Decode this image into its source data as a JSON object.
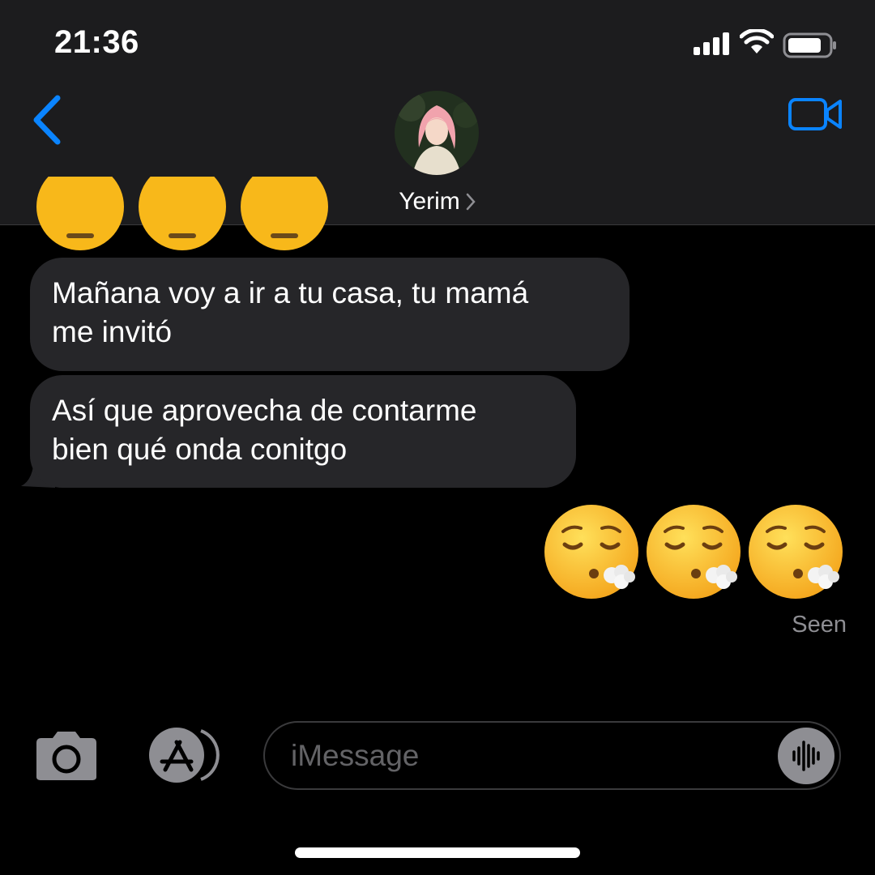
{
  "status_bar": {
    "time": "21:36"
  },
  "header": {
    "contact_name": "Yerim"
  },
  "messages": [
    {
      "side": "incoming",
      "text_line1": "Mañana voy a ir a tu casa, tu mamá",
      "text_line2": "me invitó"
    },
    {
      "side": "incoming",
      "text_line1": "Así que aprovecha de contarme",
      "text_line2": "bien qué onda conitgo"
    }
  ],
  "outgoing_emojis": [
    "face-exhaling",
    "face-exhaling",
    "face-exhaling"
  ],
  "partial_emojis": [
    "expressionless-face",
    "expressionless-face",
    "expressionless-face"
  ],
  "read_receipt": "Seen",
  "composer": {
    "placeholder": "iMessage"
  },
  "colors": {
    "accent": "#0a84ff",
    "header_bg": "#1c1c1e",
    "bubble_incoming": "#262629",
    "background": "#000000",
    "secondary_text": "#8e8e93"
  }
}
